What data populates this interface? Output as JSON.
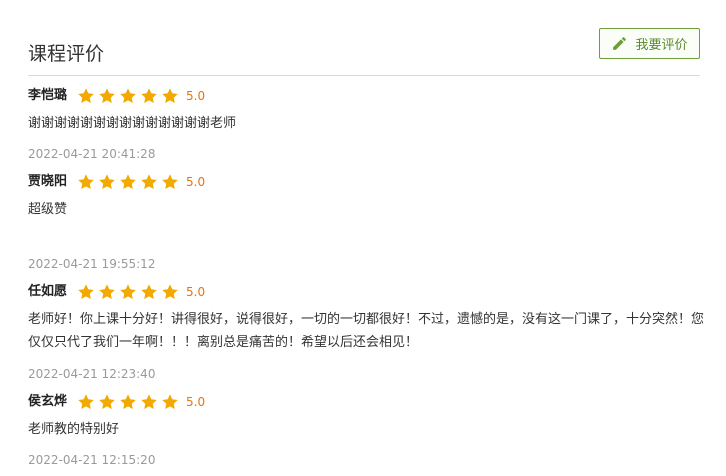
{
  "header": {
    "title": "课程评价",
    "review_button_label": "我要评价",
    "review_button_icon": "pencil-icon"
  },
  "colors": {
    "accent_green": "#6d9e3a",
    "star": "#f2a900",
    "score": "#e8740c",
    "timestamp": "#9a9a9a"
  },
  "reviews": [
    {
      "name": "李恺璐",
      "stars": 5,
      "score": "5.0",
      "comment": "谢谢谢谢谢谢谢谢谢谢谢谢谢谢老师",
      "time": "2022-04-21 20:41:28"
    },
    {
      "name": "贾晓阳",
      "stars": 5,
      "score": "5.0",
      "comment": "超级赞",
      "time": "2022-04-21 19:55:12"
    },
    {
      "name": "任如愿",
      "stars": 5,
      "score": "5.0",
      "comment": "老师好！你上课十分好！讲得很好，说得很好，一切的一切都很好！不过，遗憾的是，没有这一门课了，十分突然！您仅仅只代了我们一年啊！！！离别总是痛苦的！希望以后还会相见！",
      "time": "2022-04-21 12:23:40"
    },
    {
      "name": "侯玄烨",
      "stars": 5,
      "score": "5.0",
      "comment": "老师教的特别好",
      "time": "2022-04-21 12:15:20"
    }
  ]
}
